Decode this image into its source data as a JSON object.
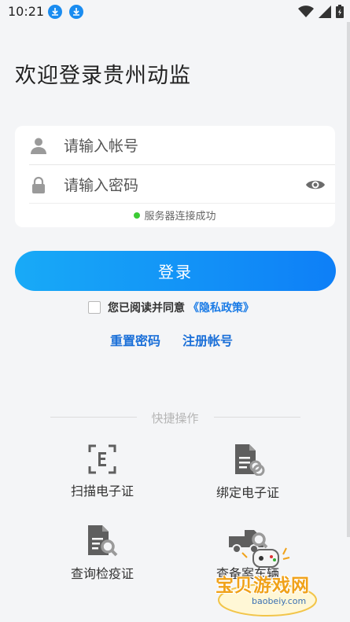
{
  "status_bar": {
    "time": "10:21"
  },
  "title": "欢迎登录贵州动监",
  "login_form": {
    "account_placeholder": "请输入帐号",
    "password_placeholder": "请输入密码",
    "server_status": "服务器连接成功",
    "status_color": "#3ccb35"
  },
  "login_button": "登录",
  "agreement": {
    "text": "您已阅读并同意",
    "link": "《隐私政策》"
  },
  "links": {
    "reset_password": "重置密码",
    "register": "注册帐号"
  },
  "quick_actions": {
    "title": "快捷操作",
    "items": [
      {
        "label": "扫描电子证",
        "icon": "scan-certificate-icon"
      },
      {
        "label": "绑定电子证",
        "icon": "bind-certificate-icon"
      },
      {
        "label": "查询检疫证",
        "icon": "search-certificate-icon"
      },
      {
        "label": "查备案车辆",
        "icon": "vehicle-search-icon"
      }
    ]
  },
  "watermark": {
    "text": "宝贝游戏网",
    "url": "baobeiy.com"
  },
  "colors": {
    "accent": "#0e7ff7",
    "link": "#1a6fd8",
    "icon_gray": "#5f5f5f"
  }
}
